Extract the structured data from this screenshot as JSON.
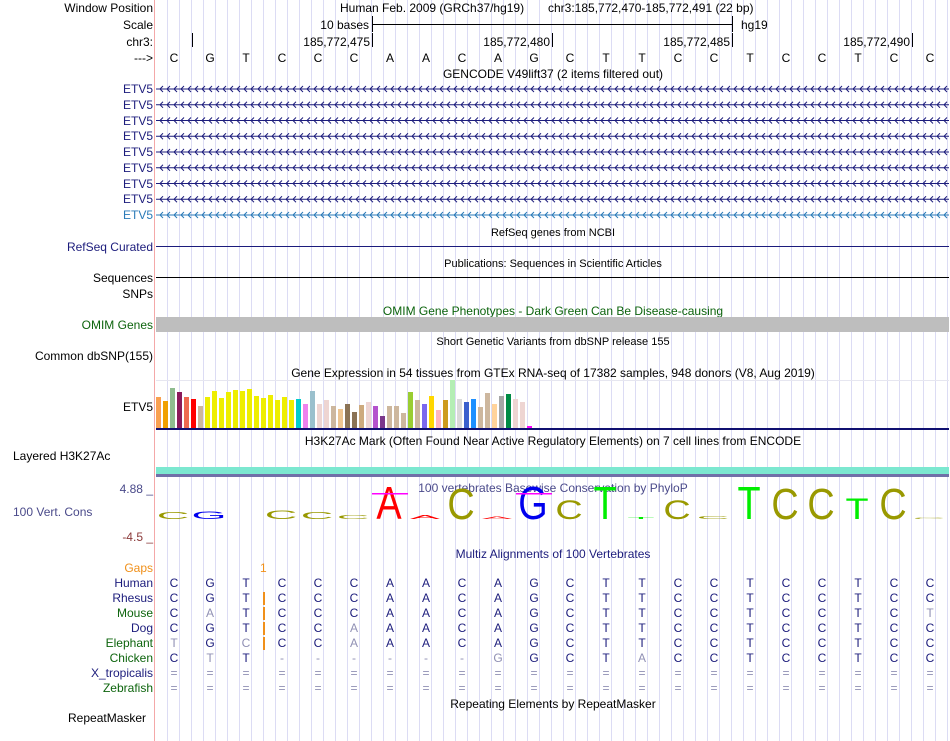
{
  "labels": {
    "window_position": "Window Position",
    "scale": "Scale",
    "chrom": "chr3:",
    "strand": "--->",
    "refseq": "RefSeq Curated",
    "sequences": "Sequences",
    "snps": "SNPs",
    "omim": "OMIM Genes",
    "dbsnp": "Common dbSNP(155)",
    "gtex": "ETV5",
    "h3k27ac": "Layered H3K27Ac",
    "cons": "100 Vert. Cons",
    "cons_max": "4.88 _",
    "cons_min": "-4.5 _",
    "gaps": "Gaps",
    "repeatmasker": "RepeatMasker"
  },
  "header": {
    "assembly": "Human Feb. 2009 (GRCh37/hg19)",
    "position": "chr3:185,772,470-185,772,491 (22 bp)",
    "scale_label": "10 bases",
    "scale_db": "hg19"
  },
  "ruler": {
    "ticks": [
      "185,772,475",
      "185,772,480",
      "185,772,485",
      "185,772,490"
    ]
  },
  "sequence": [
    "C",
    "G",
    "T",
    "C",
    "C",
    "C",
    "A",
    "A",
    "C",
    "A",
    "G",
    "C",
    "T",
    "T",
    "C",
    "C",
    "T",
    "C",
    "C",
    "T",
    "C",
    "C"
  ],
  "track_titles": {
    "gencode": "GENCODE V49lift37 (2 items filtered out)",
    "refseq": "RefSeq genes from NCBI",
    "publications": "Publications: Sequences in Scientific Articles",
    "omim": "OMIM Gene Phenotypes - Dark Green Can Be Disease-causing",
    "dbsnp": "Short Genetic Variants from dbSNP release 155",
    "gtex": "Gene Expression in 54 tissues from GTEx RNA-seq of 17382 samples, 948 donors (V8, Aug 2019)",
    "h3k27ac": "H3K27Ac Mark (Often Found Near Active Regulatory Elements) on 7 cell lines from ENCODE",
    "cons": "100 vertebrates Basewise Conservation by PhyloP",
    "multiz": "Multiz Alignments of 100 Vertebrates",
    "repeatmasker": "Repeating Elements by RepeatMasker"
  },
  "gencode_genes": [
    {
      "name": "ETV5",
      "color": "#1c1c7c"
    },
    {
      "name": "ETV5",
      "color": "#1c1c7c"
    },
    {
      "name": "ETV5",
      "color": "#1c1c7c"
    },
    {
      "name": "ETV5",
      "color": "#1c1c7c"
    },
    {
      "name": "ETV5",
      "color": "#1c1c7c"
    },
    {
      "name": "ETV5",
      "color": "#1c1c7c"
    },
    {
      "name": "ETV5",
      "color": "#1c1c7c"
    },
    {
      "name": "ETV5",
      "color": "#1c1c7c"
    },
    {
      "name": "ETV5",
      "color": "#2a7ab8"
    }
  ],
  "gene_strand": "minus",
  "gtex_bars": {
    "relative_levels_percent": [
      65,
      57,
      83,
      75,
      65,
      61,
      46,
      65,
      77,
      63,
      75,
      79,
      77,
      81,
      67,
      63,
      69,
      59,
      65,
      59,
      61,
      50,
      77,
      50,
      59,
      46,
      40,
      50,
      34,
      48,
      54,
      46,
      26,
      46,
      46,
      32,
      75,
      59,
      50,
      67,
      38,
      59,
      100,
      61,
      54,
      61,
      44,
      73,
      50,
      67,
      71,
      61,
      54,
      5
    ],
    "colors": [
      "#f9a050",
      "#f0a000",
      "#8fbc8f",
      "#8b1a5a",
      "#ee6a50",
      "#ff0000",
      "#cdb79e",
      "#eeee00",
      "#eeee00",
      "#eeee00",
      "#eeee00",
      "#eeee00",
      "#eeee00",
      "#eeee00",
      "#eeee00",
      "#eeee00",
      "#eeee00",
      "#eeee00",
      "#eeee00",
      "#eeee00",
      "#00cdcd",
      "#ee82ee",
      "#9ac0cd",
      "#eed5d2",
      "#eed5d2",
      "#cdb79e",
      "#eec591",
      "#8b7355",
      "#8b7355",
      "#cdaa7d",
      "#eed5d2",
      "#b452cd",
      "#7a378b",
      "#cdb79e",
      "#cdb79e",
      "#cdb79e",
      "#9acd32",
      "#cdb79e",
      "#7b68ee",
      "#ffd700",
      "#ffb6c1",
      "#cd9b1d",
      "#b4eeb4",
      "#d9d9d9",
      "#3a5fcd",
      "#1e90ff",
      "#cdb79e",
      "#cdb79e",
      "#ffd39b",
      "#a6a6a6",
      "#008b45",
      "#eed5d2",
      "#eed5d2",
      "#ff00ff"
    ]
  },
  "conservation": {
    "relative_height": [
      0.2,
      0.22,
      0,
      0.25,
      0.2,
      0.12,
      0.95,
      0.12,
      0.9,
      0.08,
      0.95,
      0.55,
      0.95,
      0.05,
      0.55,
      0.1,
      0.95,
      0.9,
      0.9,
      0.6,
      0.9,
      0.03
    ],
    "overline_columns": [
      6,
      10
    ],
    "letter_colors": {
      "A": "#ff0000",
      "C": "#999900",
      "G": "#0000ee",
      "T": "#00ee00"
    },
    "overline_color": "#ff00ff"
  },
  "multiz": {
    "gap_marker": {
      "text": "1",
      "after_column": 2,
      "color": "#f0901a"
    },
    "species": [
      {
        "name": "Human",
        "color": "#1c1c7c",
        "seq": "CGTCCCAACAGCTTCCTCCTCC"
      },
      {
        "name": "Rhesus",
        "color": "#1c1c7c",
        "seq": "CGTCCCAACAGCTTCCTCCTCC"
      },
      {
        "name": "Mouse",
        "color": "#0d640d",
        "seq": "CATCCCAACAGCTTCCTCCTCT"
      },
      {
        "name": "Dog",
        "color": "#1c1c7c",
        "seq": "CGTCCAAACAGCTTCCTCCTCC"
      },
      {
        "name": "Elephant",
        "color": "#0d640d",
        "seq": "TGCCCAAACAGCTTCCTCCTCC"
      },
      {
        "name": "Chicken",
        "color": "#0d640d",
        "seq": "CTT------GGCTACCTCCTCC"
      },
      {
        "name": "X_tropicalis",
        "color": "#1c1c7c",
        "seq": "======================"
      },
      {
        "name": "Zebrafish",
        "color": "#0d640d",
        "seq": "======================"
      }
    ],
    "gap_rows": [
      "Rhesus",
      "Mouse",
      "Dog",
      "Elephant"
    ]
  },
  "colors": {
    "label_navy": "#1c1c7c",
    "omim_bar": "#bebebe",
    "h3k27ac_teal": "#7ce8d0",
    "h3k27ac_purple": "#7070a8",
    "cons_label": "#4a4a8a",
    "cons_min": "#8b3a3a"
  }
}
